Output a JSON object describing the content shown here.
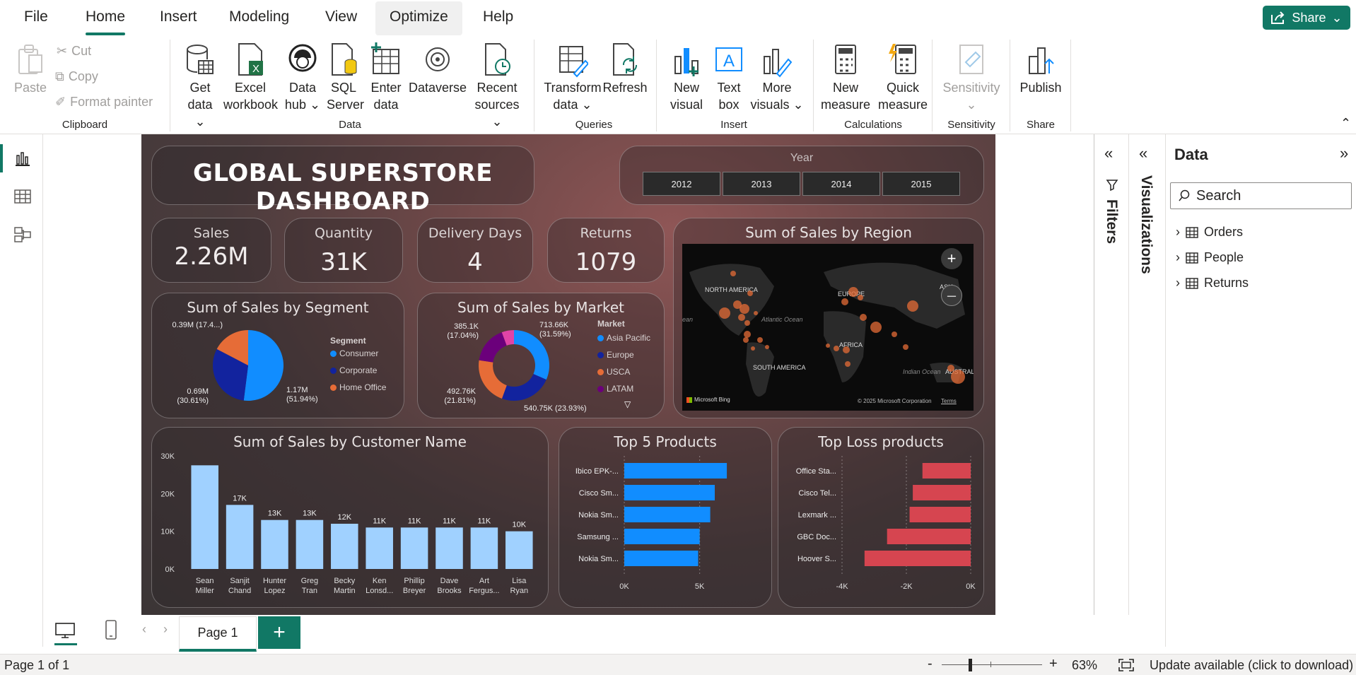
{
  "menu": {
    "tabs": [
      {
        "label": "File"
      },
      {
        "label": "Home"
      },
      {
        "label": "Insert"
      },
      {
        "label": "Modeling"
      },
      {
        "label": "View"
      },
      {
        "label": "Optimize"
      },
      {
        "label": "Help"
      }
    ],
    "share_label": "Share"
  },
  "ribbon": {
    "clipboard": {
      "paste": "Paste",
      "cut": "Cut",
      "copy": "Copy",
      "format_painter": "Format painter",
      "group": "Clipboard"
    },
    "data": {
      "get_data": [
        "Get",
        "data"
      ],
      "excel": [
        "Excel",
        "workbook"
      ],
      "data_hub": [
        "Data",
        "hub"
      ],
      "sql": [
        "SQL",
        "Server"
      ],
      "enter": [
        "Enter",
        "data"
      ],
      "dataverse": "Dataverse",
      "recent": [
        "Recent",
        "sources"
      ],
      "group": "Data"
    },
    "queries": {
      "transform": [
        "Transform",
        "data"
      ],
      "refresh": "Refresh",
      "group": "Queries"
    },
    "insert": {
      "new_visual": [
        "New",
        "visual"
      ],
      "text_box": [
        "Text",
        "box"
      ],
      "more_visuals": [
        "More",
        "visuals"
      ],
      "group": "Insert"
    },
    "calculations": {
      "new_measure": [
        "New",
        "measure"
      ],
      "quick_measure": [
        "Quick",
        "measure"
      ],
      "group": "Calculations"
    },
    "sensitivity": {
      "label": "Sensitivity",
      "group": "Sensitivity"
    },
    "share": {
      "publish": "Publish",
      "group": "Share"
    }
  },
  "dashboard": {
    "title": "GLOBAL SUPERSTORE DASHBOARD",
    "year_slicer": {
      "label": "Year",
      "options": [
        "2012",
        "2013",
        "2014",
        "2015"
      ]
    },
    "kpis": [
      {
        "label": "Sales",
        "value": "2.26M"
      },
      {
        "label": "Quantity",
        "value": "31K"
      },
      {
        "label": "Delivery Days",
        "value": "4"
      },
      {
        "label": "Returns",
        "value": "1079"
      }
    ],
    "map": {
      "title": "Sum of Sales by Region",
      "labels": {
        "na": "NORTH AMERICA",
        "eu": "EUROPE",
        "asia": "ASIA",
        "atlantic": "Atlantic Ocean",
        "sa": "SOUTH AMERICA",
        "africa": "AFRICA",
        "indian": "Indian Ocean",
        "aus": "AUSTRAL",
        "ocean_left": "ean"
      },
      "bing": "Microsoft Bing",
      "copyright": "© 2025 Microsoft Corporation",
      "terms": "Terms"
    }
  },
  "chart_data": [
    {
      "type": "pie",
      "title": "Sum of Sales by Segment",
      "legend_title": "Segment",
      "categories": [
        "Consumer",
        "Corporate",
        "Home Office"
      ],
      "values": [
        1.17,
        0.69,
        0.39
      ],
      "labels": [
        "1.17M\n(51.94%)",
        "0.69M\n(30.61%)",
        "0.39M (17.4...)"
      ],
      "colors": [
        "#118dff",
        "#12239e",
        "#e66c37"
      ]
    },
    {
      "type": "pie",
      "subtype": "donut",
      "title": "Sum of Sales by Market",
      "legend_title": "Market",
      "categories": [
        "Asia Pacific",
        "Europe",
        "USCA",
        "LATAM"
      ],
      "values": [
        713.66,
        540.75,
        492.76,
        385.1
      ],
      "labels": [
        "713.66K\n(31.59%)",
        "540.75K (23.93%)",
        "492.76K\n(21.81%)",
        "385.1K\n(17.04%)"
      ],
      "colors": [
        "#118dff",
        "#12239e",
        "#e66c37",
        "#6b007b",
        "#e044a7"
      ],
      "other_value": 126.5
    },
    {
      "type": "bar",
      "title": "Sum of Sales by Customer Name",
      "categories": [
        "Sean Miller",
        "Sanjit Chand",
        "Hunter Lopez",
        "Greg Tran",
        "Becky Martin",
        "Ken Lonsd...",
        "Phillip Breyer",
        "Dave Brooks",
        "Art Fergus...",
        "Lisa Ryan"
      ],
      "values": [
        27.5,
        17,
        13,
        13,
        12,
        11,
        11,
        11,
        11,
        10
      ],
      "data_labels": [
        "",
        "17K",
        "13K",
        "13K",
        "12K",
        "11K",
        "11K",
        "11K",
        "11K",
        "10K"
      ],
      "y_ticks": [
        "30K",
        "20K",
        "10K",
        "0K"
      ],
      "ylim": [
        0,
        30
      ],
      "color": "#a0d1ff"
    },
    {
      "type": "bar",
      "orientation": "horizontal",
      "title": "Top 5 Products",
      "categories": [
        "Ibico EPK-...",
        "Cisco Sm...",
        "Nokia Sm...",
        "Samsung ...",
        "Nokia Sm..."
      ],
      "values": [
        6.8,
        6.0,
        5.7,
        5.0,
        4.9
      ],
      "x_ticks": [
        "0K",
        "5K"
      ],
      "xlim": [
        0,
        7.5
      ],
      "color": "#118dff"
    },
    {
      "type": "bar",
      "orientation": "horizontal",
      "title": "Top Loss products",
      "categories": [
        "Office Sta...",
        "Cisco Tel...",
        "Lexmark ...",
        "GBC Doc...",
        "Hoover S..."
      ],
      "values": [
        -1.5,
        -1.8,
        -1.9,
        -2.6,
        -3.3
      ],
      "x_ticks": [
        "-4K",
        "-2K",
        "0K"
      ],
      "xlim": [
        -4,
        0
      ],
      "color": "#d64550"
    }
  ],
  "filters": {
    "label": "Filters"
  },
  "visualizations": {
    "label": "Visualizations"
  },
  "data_pane": {
    "title": "Data",
    "search_placeholder": "Search",
    "tables": [
      {
        "name": "Orders"
      },
      {
        "name": "People"
      },
      {
        "name": "Returns"
      }
    ]
  },
  "pages": {
    "current": "Page 1",
    "add": "+"
  },
  "status": {
    "page_info": "Page 1 of 1",
    "zoom": "63%",
    "update": "Update available (click to download)",
    "minus": "-",
    "plus": "+"
  },
  "colors": {
    "accent": "#117865",
    "blue": "#118dff",
    "navy": "#12239e",
    "orange": "#e66c37",
    "purple": "#6b007b",
    "pink": "#e044a7",
    "red": "#d64550",
    "light_blue": "#a0d1ff"
  }
}
